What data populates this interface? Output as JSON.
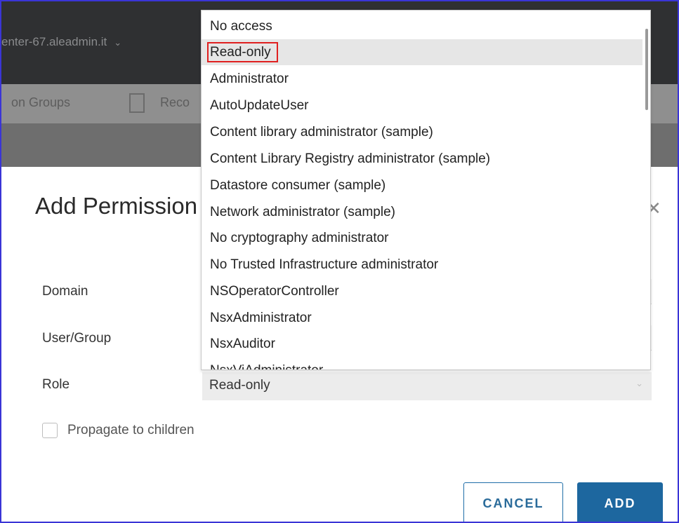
{
  "app": {
    "title": "enter-67.aleadmin.it",
    "toolbar_left": "on Groups",
    "toolbar_right": "Reco"
  },
  "modal": {
    "title": "Add Permission",
    "fields": {
      "domain_label": "Domain",
      "user_group_label": "User/Group",
      "role_label": "Role",
      "role_value": "Read-only"
    },
    "propagate_label": "Propagate to children",
    "propagate_checked": false,
    "cancel_label": "CANCEL",
    "add_label": "ADD"
  },
  "dropdown": {
    "selected": "Read-only",
    "options": [
      "No access",
      "Read-only",
      "Administrator",
      "AutoUpdateUser",
      "Content library administrator (sample)",
      "Content Library Registry administrator (sample)",
      "Datastore consumer (sample)",
      "Network administrator (sample)",
      "No cryptography administrator",
      "No Trusted Infrastructure administrator",
      "NSOperatorController",
      "NsxAdministrator",
      "NsxAuditor",
      "NsxViAdministrator"
    ]
  },
  "colors": {
    "accent": "#1d679f",
    "highlight_border": "#e02020",
    "frame_border": "#3a35d6"
  }
}
